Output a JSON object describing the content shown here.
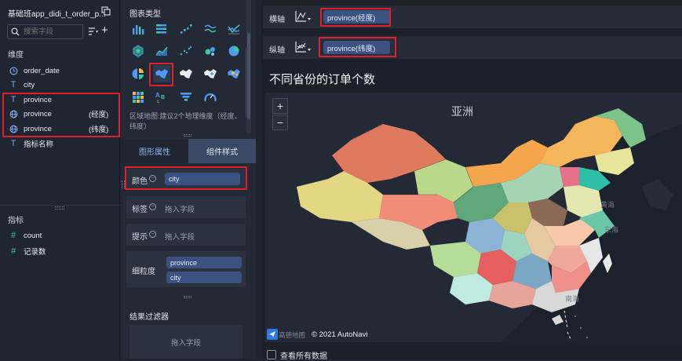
{
  "left": {
    "dataset_title": "基础班app_didi_t_order_p...",
    "search_placeholder": "搜索字段",
    "dim_header": "维度",
    "dims": [
      {
        "icon": "clock-icon",
        "label": "order_date",
        "suffix": ""
      },
      {
        "icon": "text-type-icon",
        "label": "city",
        "suffix": ""
      },
      {
        "icon": "text-type-icon",
        "label": "province",
        "suffix": ""
      },
      {
        "icon": "globe-icon",
        "label": "province",
        "suffix": "(经度)"
      },
      {
        "icon": "globe-icon",
        "label": "province",
        "suffix": "(纬度)"
      },
      {
        "icon": "text-type-icon",
        "label": "指标名称",
        "suffix": ""
      }
    ],
    "measure_header": "指标",
    "measures": [
      {
        "icon": "hash-icon",
        "label": "count"
      },
      {
        "icon": "hash-calc-icon",
        "label": "记录数"
      }
    ]
  },
  "mid": {
    "chart_type_header": "图表类型",
    "chart_types": [
      "bar-chart-icon",
      "stacked-bar-icon",
      "scatter-trend-icon",
      "wave-line-icon",
      "line-check-icon",
      "hex-map-icon",
      "area-line-icon",
      "dot-scatter-icon",
      "bubble-icon",
      "pie-icon",
      "pie-split-icon",
      "china-region-map-icon",
      "china-map-icon",
      "china-point-map-icon",
      "china-bubble-map-icon",
      "heatmap-grid-icon",
      "word-cloud-icon",
      "funnel-icon",
      "gauge-icon"
    ],
    "hint": "区域地图:建议2个地理维度（经度、纬度）",
    "tab_props": "图形属性",
    "tab_style": "组件样式",
    "color_label": "颜色",
    "color_value": "city",
    "tag_label": "标签",
    "tag_placeholder": "拖入字段",
    "tip_label": "提示",
    "tip_placeholder": "拖入字段",
    "granularity_label": "细粒度",
    "granularity_values": [
      "province",
      "city"
    ],
    "filter_header": "结果过滤器",
    "filter_placeholder": "拖入字段"
  },
  "right": {
    "x_axis_label": "横轴",
    "x_axis_value": "province(经度)",
    "y_axis_label": "纵轴",
    "y_axis_value": "province(纬度)",
    "chart_title": "不同省份的订单个数",
    "zoom_in": "+",
    "zoom_out": "−",
    "map_labels": {
      "asia": "亚洲",
      "yellow_sea": "黄海",
      "east_sea": "东海",
      "south_sea": "南海"
    },
    "copyright": "© 2021 AutoNavi",
    "logo_text": "高德地图",
    "view_all_label": "查看所有数据"
  },
  "colors": {
    "accent": "#3b5280",
    "highlight_red": "#e0202a",
    "tab_active": "#3a4a66"
  }
}
